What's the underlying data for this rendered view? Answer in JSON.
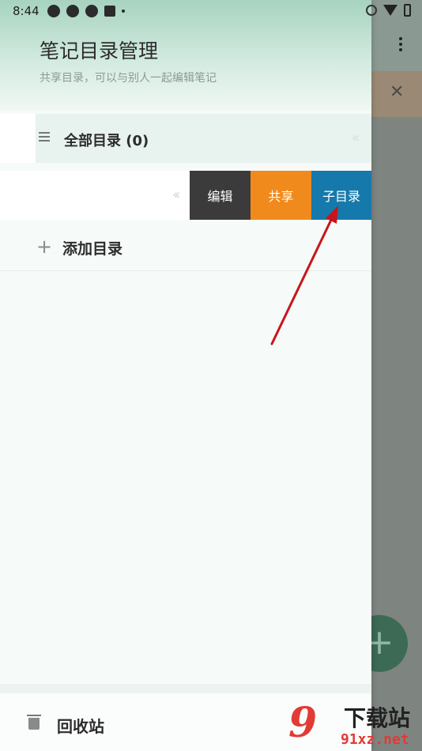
{
  "status_bar": {
    "time": "8:44",
    "left_icons": [
      "app-icon",
      "app-icon",
      "app-icon",
      "a-icon",
      "dot"
    ],
    "right_icons": [
      "alarm-icon",
      "wifi-icon",
      "battery-icon"
    ]
  },
  "drawer": {
    "title": "笔记目录管理",
    "subtitle": "共享目录，可以与别人一起编辑笔记",
    "all_directories_label": "全部目录 (0)",
    "swipe_actions": {
      "edit": "编辑",
      "share": "共享",
      "subdirectory": "子目录"
    },
    "add_directory_label": "添加目录",
    "recycle_bin_label": "回收站"
  },
  "background_app": {
    "close_symbol": "✕",
    "fab_symbol": "+"
  },
  "watermark": {
    "logo_text": "9",
    "chinese": "下载站",
    "domain": "91xz.net"
  },
  "colors": {
    "edit": "#3b3b3b",
    "share": "#f08a1c",
    "subdirectory": "#1679ac",
    "arrow": "#c7161b"
  }
}
